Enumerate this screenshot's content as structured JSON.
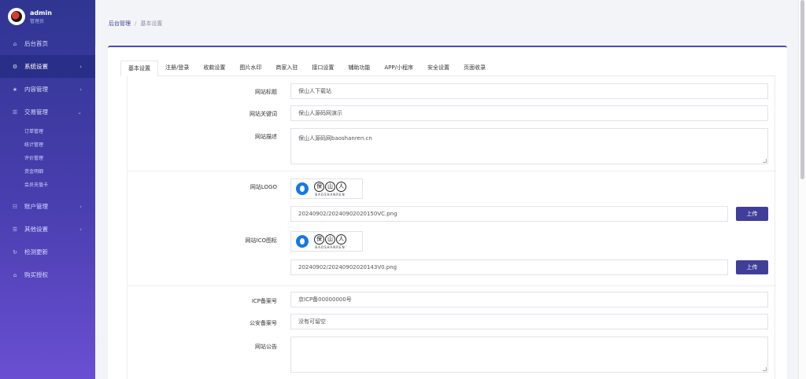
{
  "user": {
    "name": "admin",
    "role": "管理员"
  },
  "sidebar": {
    "items": [
      {
        "icon": "home-icon",
        "glyph": "⌂",
        "label": "后台首页"
      },
      {
        "icon": "gear-icon",
        "glyph": "⚙",
        "label": "系统设置",
        "active": true,
        "chev": "›"
      },
      {
        "icon": "star-icon",
        "glyph": "★",
        "label": "内容管理",
        "chev": "›"
      },
      {
        "icon": "list-icon",
        "glyph": "☰",
        "label": "交易管理",
        "chev": "⌄",
        "children": [
          "订单管理",
          "统计管理",
          "评价管理",
          "资金明细",
          "会员充值卡"
        ]
      },
      {
        "icon": "users-icon",
        "glyph": "☷",
        "label": "账户管理",
        "chev": "›"
      },
      {
        "icon": "list-icon",
        "glyph": "☰",
        "label": "其他设置",
        "chev": "›"
      },
      {
        "icon": "refresh-icon",
        "glyph": "↻",
        "label": "检测更新"
      },
      {
        "icon": "home-icon",
        "glyph": "⌂",
        "label": "购买授权"
      }
    ]
  },
  "breadcrumb": {
    "home": "后台管理",
    "sep": "/",
    "current": "基本设置"
  },
  "tabs": [
    "基本设置",
    "注册/登录",
    "收款设置",
    "图片水印",
    "商家入驻",
    "接口设置",
    "辅助功能",
    "APP/小程序",
    "安全设置",
    "页面收录"
  ],
  "form": {
    "site_title_label": "网站标题",
    "site_title_value": "保山人下载站",
    "keywords_label": "网站关键词",
    "keywords_value": "保山人源码网演示",
    "description_label": "网站描述",
    "description_value": "保山人源码网baoshanren.cn",
    "logo_label": "网站LOGO",
    "logo_path": "20240902/20240902020150VC.png",
    "ico_label": "网站ICO图标",
    "ico_path": "20240902/20240902020143V0.png",
    "upload_label": "上传",
    "logo_chars": [
      "保",
      "山",
      "人"
    ],
    "logo_sub": "BAOSHANREN",
    "icp_label": "ICP备案号",
    "icp_value": "京ICP备00000000号",
    "police_label": "公安备案号",
    "police_value": "没有可留空",
    "notice_label": "网站公告",
    "notice_value": ""
  }
}
